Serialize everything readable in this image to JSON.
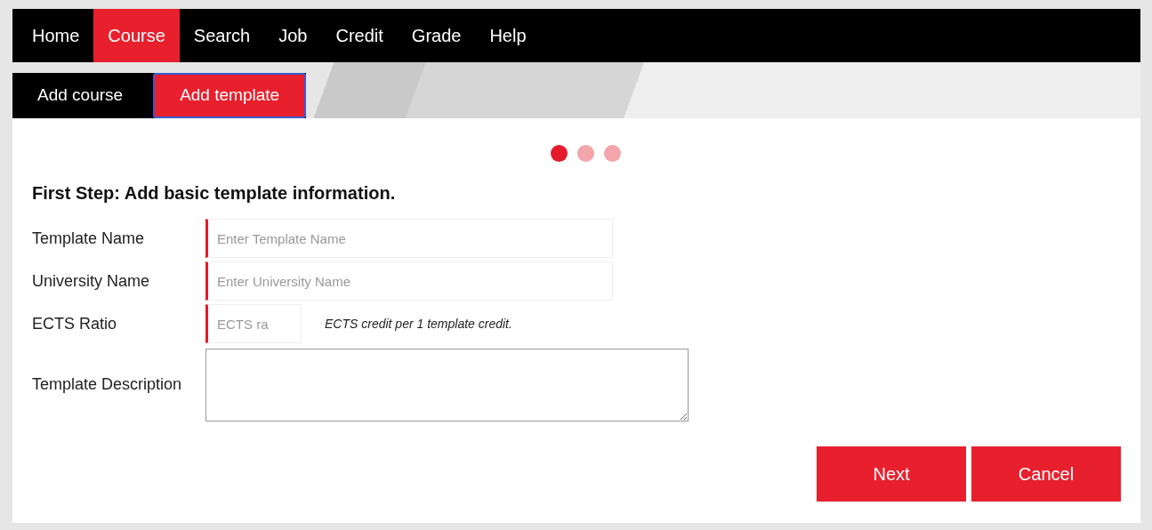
{
  "nav": [
    {
      "label": "Home",
      "selected": false
    },
    {
      "label": "Course",
      "selected": true
    },
    {
      "label": "Search",
      "selected": false
    },
    {
      "label": "Job",
      "selected": false
    },
    {
      "label": "Credit",
      "selected": false
    },
    {
      "label": "Grade",
      "selected": false
    },
    {
      "label": "Help",
      "selected": false
    }
  ],
  "subtabs": [
    {
      "label": "Add course",
      "selected": false
    },
    {
      "label": "Add template",
      "selected": true
    }
  ],
  "steps": [
    {
      "selected": true
    },
    {
      "selected": false
    },
    {
      "selected": false
    }
  ],
  "heading": "First Step: Add basic template information.",
  "fields": [
    {
      "kind": "text",
      "label": "Template Name",
      "placeholder": "Enter Template Name",
      "required": true
    },
    {
      "kind": "text",
      "label": "University Name",
      "placeholder": "Enter University Name",
      "required": true
    },
    {
      "kind": "short",
      "label": "ECTS Ratio",
      "placeholder": "ECTS ra",
      "required": true,
      "note": "ECTS credit per 1 template credit."
    },
    {
      "kind": "textarea",
      "label": "Template Description",
      "required": false
    }
  ],
  "buttons": [
    "Next",
    "Cancel"
  ]
}
